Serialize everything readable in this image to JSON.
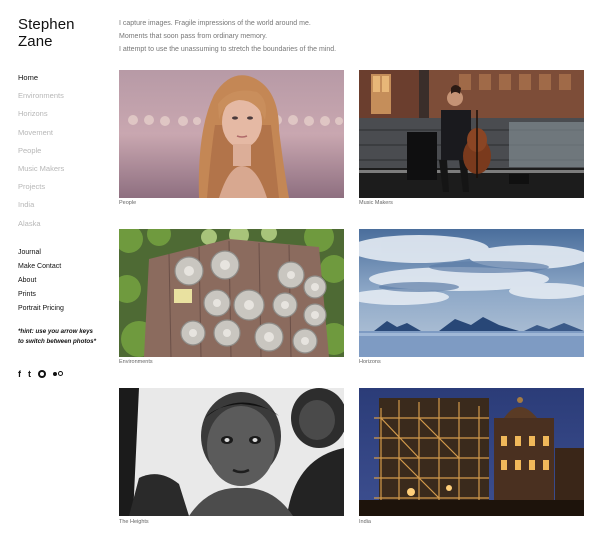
{
  "site": {
    "title_line1": "Stephen",
    "title_line2": "Zane"
  },
  "gallery_nav": [
    {
      "label": "Home",
      "active": true
    },
    {
      "label": "Environments",
      "active": false
    },
    {
      "label": "Horizons",
      "active": false
    },
    {
      "label": "Movement",
      "active": false
    },
    {
      "label": "People",
      "active": false
    },
    {
      "label": "Music Makers",
      "active": false
    },
    {
      "label": "Projects",
      "active": false
    },
    {
      "label": "India",
      "active": false
    },
    {
      "label": "Alaska",
      "active": false
    }
  ],
  "page_nav": [
    {
      "label": "Journal"
    },
    {
      "label": "Make Contact"
    },
    {
      "label": "About"
    },
    {
      "label": "Prints"
    },
    {
      "label": "Portrait Pricing"
    }
  ],
  "hint": "*hint: use you arrow keys to switch between photos*",
  "social": [
    {
      "icon": "facebook-icon",
      "glyph": "f"
    },
    {
      "icon": "tumblr-icon",
      "glyph": "t"
    },
    {
      "icon": "circle-icon",
      "glyph": ""
    },
    {
      "icon": "flickr-icon",
      "glyph": ""
    }
  ],
  "intro": {
    "line1": "I capture images. Fragile impressions of the world around me.",
    "line2": "Moments that soon pass from ordinary memory.",
    "line3": "I attempt to use the unassuming to stretch the boundaries of the mind."
  },
  "gallery": [
    {
      "caption": "People"
    },
    {
      "caption": "Music Makers"
    },
    {
      "caption": "Environments"
    },
    {
      "caption": "Horizons"
    },
    {
      "caption": "The Heights"
    },
    {
      "caption": "India"
    }
  ]
}
